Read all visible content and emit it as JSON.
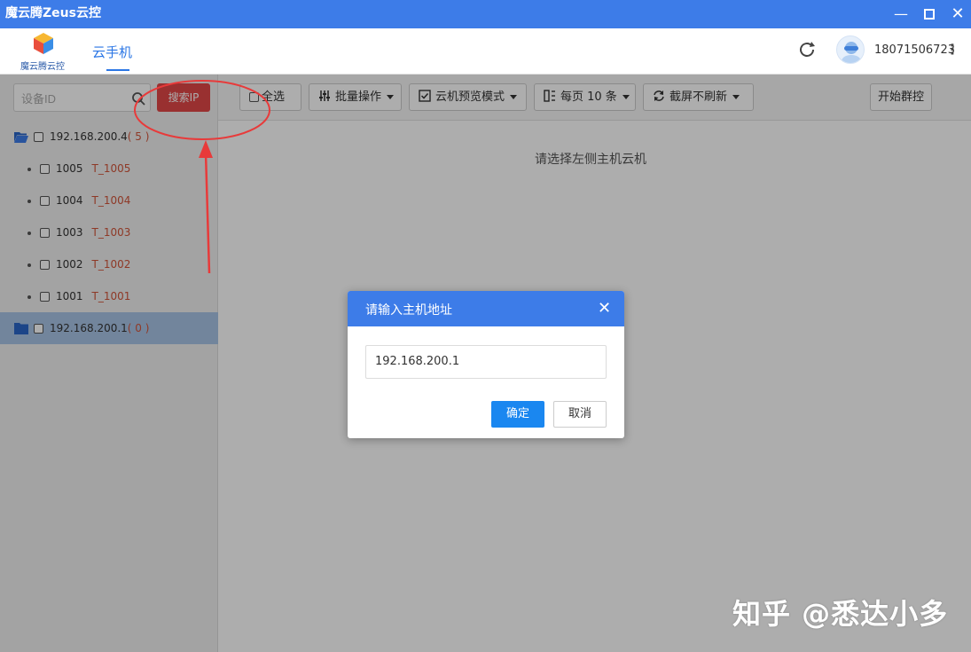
{
  "window": {
    "title": "魔云腾Zeus云控",
    "minimize_icon": "minimize-icon",
    "maximize_icon": "maximize-icon",
    "close_icon": "close-icon",
    "accent": "#3d7ce8"
  },
  "header": {
    "logo_text": "魔云腾云控",
    "tab_label": "云手机",
    "phone": "18071506723",
    "refresh_icon": "refresh-icon",
    "more_icon": "more-vertical-icon"
  },
  "sidebar": {
    "search_placeholder": "设备ID",
    "search_ip_label": "搜索IP",
    "groups": [
      {
        "ip": "192.168.200.4",
        "count": "( 5 )",
        "devices": [
          {
            "id": "1005",
            "name": "T_1005"
          },
          {
            "id": "1004",
            "name": "T_1004"
          },
          {
            "id": "1003",
            "name": "T_1003"
          },
          {
            "id": "1002",
            "name": "T_1002"
          },
          {
            "id": "1001",
            "name": "T_1001"
          }
        ]
      },
      {
        "ip": "192.168.200.1",
        "count": "( 0 )"
      }
    ]
  },
  "toolbar": {
    "select_all": "全选",
    "batch_ops": "批量操作",
    "preview_mode": "云机预览模式",
    "per_page": "每页 10 条",
    "screenshot": "截屏不刷新",
    "group_control": "开始群控"
  },
  "main": {
    "hint": "请选择左侧主机云机",
    "watermark": "知乎 @悉达小多"
  },
  "dialog": {
    "title": "请输入主机地址",
    "input_value": "192.168.200.1",
    "confirm": "确定",
    "cancel": "取消",
    "close_icon": "close-icon"
  },
  "colors": {
    "search_ip_button": "#e24848",
    "primary_button": "#1a87f0",
    "device_name": "#d2553a",
    "annotation": "#e83a3a"
  }
}
